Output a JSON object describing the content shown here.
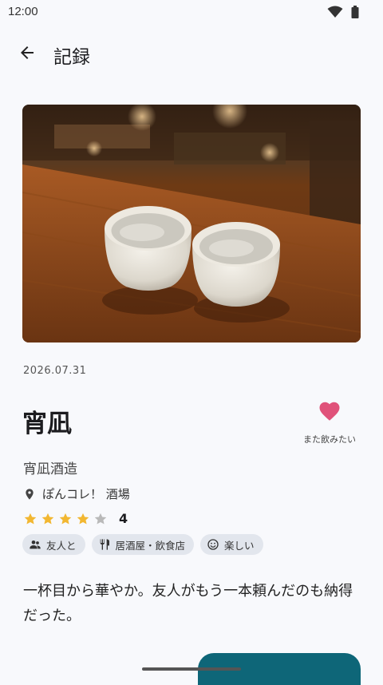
{
  "status_bar": {
    "time": "12:00",
    "icons": [
      "wifi-icon",
      "battery-icon"
    ]
  },
  "app_bar": {
    "title": "記録",
    "back_icon": "arrow-back-icon"
  },
  "record": {
    "date": "2026.07.31",
    "name": "宵凪",
    "brewery": "宵凪酒造",
    "place": "ぽんコレ！ 酒場",
    "rating": 4,
    "rating_max": 5,
    "rating_label": "4",
    "favorite": {
      "label": "また飲みたい",
      "active": true,
      "color": "#e0527a"
    },
    "tags": [
      {
        "icon": "group-icon",
        "label": "友人と"
      },
      {
        "icon": "restaurant-icon",
        "label": "居酒屋・飲食店"
      },
      {
        "icon": "smile-icon",
        "label": "楽しい"
      }
    ],
    "memo": "一杯目から華やか。友人がもう一本頼んだのも納得だった。"
  },
  "colors": {
    "accent": "#0e6678",
    "star": "#f2b731",
    "star_empty": "#b9b9b9",
    "chip_bg": "#e2e6ed"
  }
}
